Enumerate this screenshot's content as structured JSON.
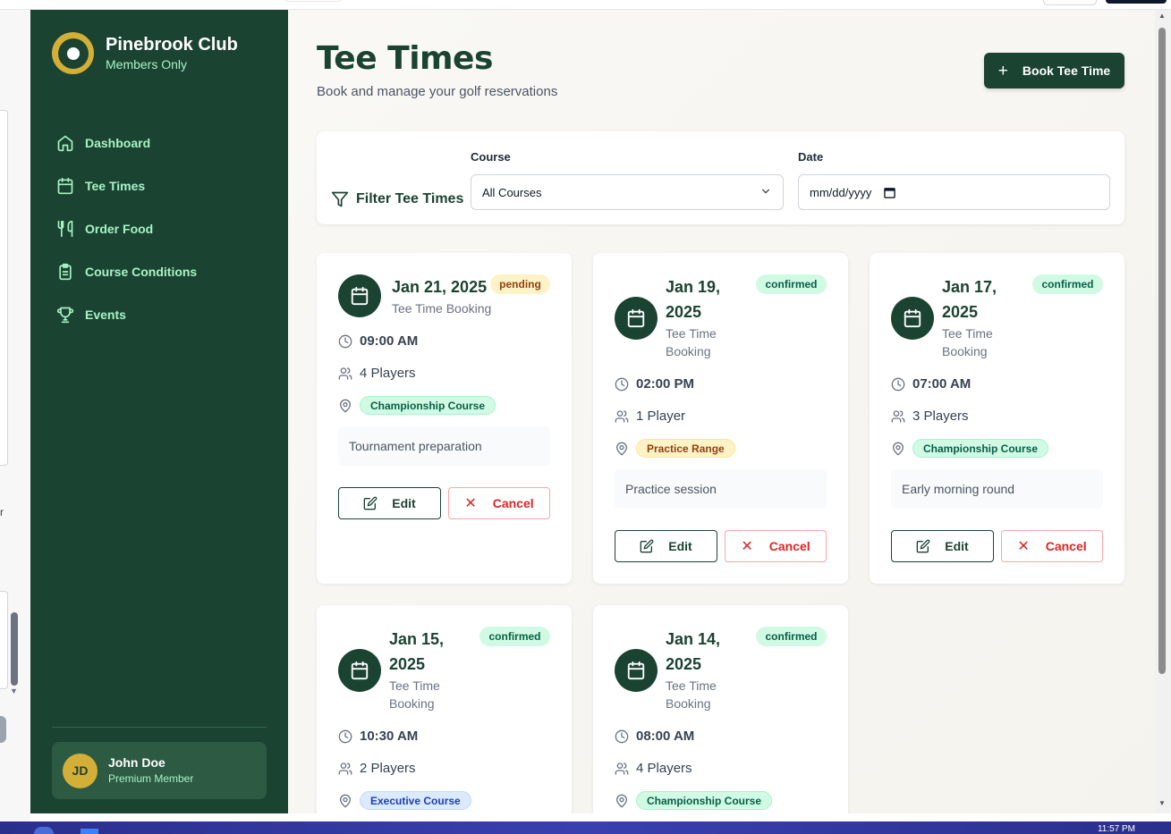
{
  "brand": {
    "name": "Pinebrook Club",
    "subtitle": "Members Only"
  },
  "nav": [
    {
      "label": "Dashboard",
      "icon": "home-icon"
    },
    {
      "label": "Tee Times",
      "icon": "calendar-icon"
    },
    {
      "label": "Order Food",
      "icon": "utensils-icon"
    },
    {
      "label": "Course Conditions",
      "icon": "clipboard-icon"
    },
    {
      "label": "Events",
      "icon": "trophy-icon"
    }
  ],
  "user": {
    "initials": "JD",
    "name": "John Doe",
    "role": "Premium Member"
  },
  "header": {
    "title": "Tee Times",
    "subtitle": "Book and manage your golf reservations",
    "book_label": "Book Tee Time"
  },
  "filter": {
    "title": "Filter Tee Times",
    "course_label": "Course",
    "course_value": "All Courses",
    "date_label": "Date",
    "date_placeholder": "mm/dd/yyyy"
  },
  "bookings": [
    {
      "date": "Jan 21, 2025",
      "type": "Tee Time Booking",
      "status": "pending",
      "time": "09:00 AM",
      "players": "4 Players",
      "course": "Championship Course",
      "course_color": "green",
      "note": "Tournament preparation",
      "edit_label": "Edit",
      "cancel_label": "Cancel"
    },
    {
      "date_line1": "Jan 19,",
      "date_line2": "2025",
      "type_line1": "Tee Time",
      "type_line2": "Booking",
      "status": "confirmed",
      "time": "02:00 PM",
      "players": "1 Player",
      "course": "Practice Range",
      "course_color": "amber",
      "note": "Practice session",
      "edit_label": "Edit",
      "cancel_label": "Cancel"
    },
    {
      "date_line1": "Jan 17,",
      "date_line2": "2025",
      "type_line1": "Tee Time",
      "type_line2": "Booking",
      "status": "confirmed",
      "time": "07:00 AM",
      "players": "3 Players",
      "course": "Championship Course",
      "course_color": "green",
      "note": "Early morning round",
      "edit_label": "Edit",
      "cancel_label": "Cancel"
    },
    {
      "date_line1": "Jan 15,",
      "date_line2": "2025",
      "type_line1": "Tee Time",
      "type_line2": "Booking",
      "status": "confirmed",
      "time": "10:30 AM",
      "players": "2 Players",
      "course": "Executive Course",
      "course_color": "blue"
    },
    {
      "date_line1": "Jan 14,",
      "date_line2": "2025",
      "type_line1": "Tee Time",
      "type_line2": "Booking",
      "status": "confirmed",
      "time": "08:00 AM",
      "players": "4 Players",
      "course": "Championship Course",
      "course_color": "green"
    }
  ],
  "taskbar": {
    "clock": "11:57 PM"
  },
  "colors": {
    "primary": "#1b4332",
    "gold": "#d4af37",
    "mint": "#a7f3c7",
    "danger": "#dc2626"
  }
}
